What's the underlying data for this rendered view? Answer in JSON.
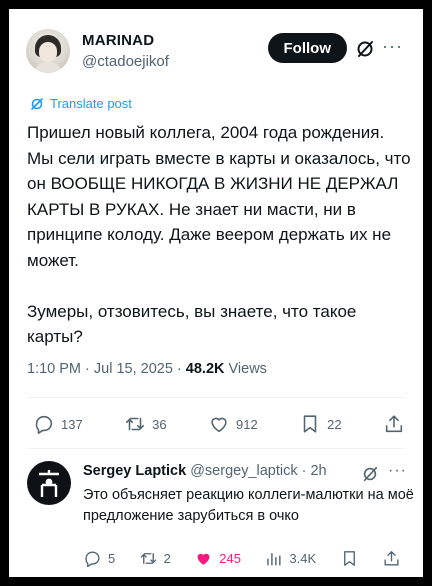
{
  "post": {
    "author_name": "MARINAD",
    "author_handle": "@ctadoejikof",
    "follow_label": "Follow",
    "more_label": "···",
    "translate_label": "Translate post",
    "text": "Пришел новый коллега, 2004 года рождения. Мы сели играть вместе в карты и оказалось, что он ВООБЩЕ НИКОГДА В ЖИЗНИ НЕ ДЕРЖАЛ КАРТЫ В РУКАХ. Не знает ни масти, ни в принципе колоду. Даже веером держать их не может.\n\nЗумеры, отзовитесь, вы знаете, что такое карты?",
    "time": "1:10 PM · Jul 15, 2025 · ",
    "views_count": "48.2K",
    "views_label": " Views",
    "actions": {
      "replies": "137",
      "reposts": "36",
      "likes": "912",
      "bookmarks": "22"
    }
  },
  "reply": {
    "name": "Sergey Laptick",
    "meta": " @sergey_laptick · 2h",
    "more_label": "···",
    "text": "Это объясняет реакцию коллеги-малютки на моё предложение зарубиться в очко",
    "actions": {
      "replies": "5",
      "reposts": "2",
      "likes": "245",
      "views": "3.4K"
    }
  },
  "icons": {
    "reply": "reply-icon",
    "repost": "repost-icon",
    "like": "heart-icon",
    "bookmark": "bookmark-icon",
    "share": "share-icon",
    "views": "views-icon",
    "grok": "grok-icon",
    "translate": "translate-icon"
  },
  "colors": {
    "accent": "#1d9bf0",
    "text": "#0f1419",
    "secondary": "#536471",
    "like_active": "#f91880",
    "follow_bg": "#0f1419"
  }
}
